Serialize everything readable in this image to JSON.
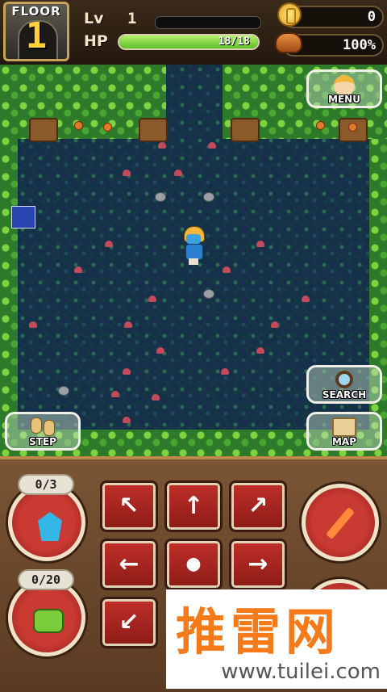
{
  "hud": {
    "floor_label": "FLOOR",
    "floor_number": "1",
    "level_label": "Lv",
    "level_value": "1",
    "hp_label": "HP",
    "hp_text": "18/18",
    "hp_fraction": 1.0,
    "gold": "0",
    "food": "100%"
  },
  "buttons": {
    "menu": "MENU",
    "search": "SEARCH",
    "step": "STEP",
    "map": "MAP"
  },
  "inventory": {
    "crystal_count": "0/3",
    "bag_count": "0/20"
  },
  "dpad": {
    "up_left": "↖",
    "up": "↑",
    "up_right": "↗",
    "left": "←",
    "center": "●",
    "right": "→",
    "down_left": "↙"
  },
  "icons": {
    "floor": "door-icon",
    "gold": "coin-icon",
    "food": "bread-icon",
    "menu": "hero-face-icon",
    "search": "magnifier-icon",
    "step": "footprints-icon",
    "map": "scroll-map-icon",
    "crystal": "crystal-icon",
    "bag": "backpack-icon",
    "attack": "sword-icon"
  },
  "colors": {
    "hp": "#5dbf2a",
    "accent": "#c93a32",
    "gold": "#ffd23a"
  },
  "watermark": {
    "logo": "推雷网",
    "url": "www.tuilei.com"
  }
}
